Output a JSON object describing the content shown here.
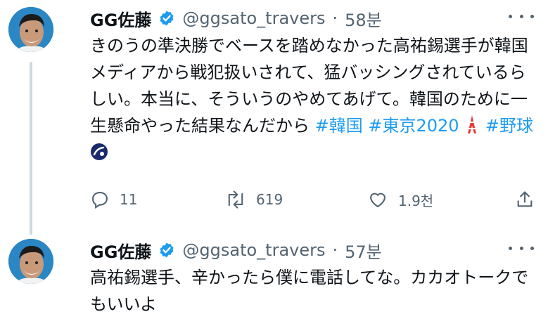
{
  "tweets": [
    {
      "name": "GG佐藤",
      "handle": "@ggsato_travers",
      "sep": "·",
      "time": "58분",
      "text_plain": "きのうの準決勝でベースを踏めなかった高祐錫選手が韓国メディアから戦犯扱いされて、猛バッシングされているらしい。本当に、そういうのやめてあげて。韓国のために一生懸命やった結果なんだから ",
      "hashtag1": "#韓国",
      "hashtag2": "#東京2020",
      "hashtag3": "#野球",
      "reply_count": "11",
      "retweet_count": "619",
      "like_count": "1.9천"
    },
    {
      "name": "GG佐藤",
      "handle": "@ggsato_travers",
      "sep": "·",
      "time": "57분",
      "text_plain": "高祐錫選手、辛かったら僕に電話してな。カカオトークでもいいよ"
    }
  ],
  "colors": {
    "accent": "#1d9bf0",
    "muted": "#536471",
    "text": "#0f1419",
    "verified": "#1d9bf0"
  },
  "icons": [
    "verified-badge-icon",
    "more-icon",
    "reply-icon",
    "retweet-icon",
    "like-icon",
    "share-icon",
    "tokyo-tower-emoji",
    "baseball-hashflag-icon"
  ]
}
